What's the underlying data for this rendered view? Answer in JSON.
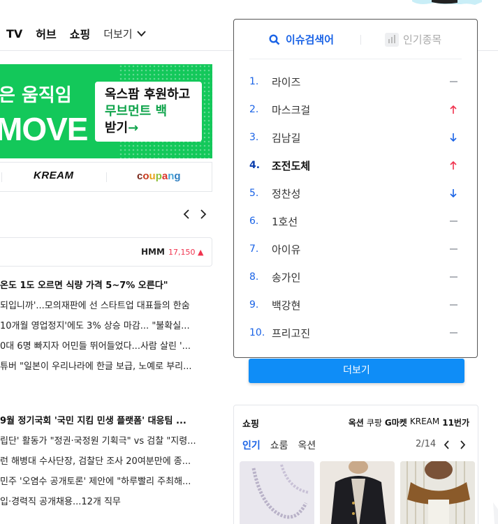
{
  "topnav": {
    "items": [
      "TV",
      "허브",
      "쇼핑"
    ],
    "more_label": "더보기"
  },
  "banner": {
    "line1": "은 움직임",
    "line2": "MOVE",
    "card_line1": "옥스팜 후원하고",
    "card_line2": "무브먼트 백",
    "card_line3": "받기",
    "card_arrow": "→"
  },
  "brands": {
    "kream": "KREAM",
    "coupang": [
      "c",
      "o",
      "u",
      "p",
      "a",
      "n",
      "g"
    ]
  },
  "stock": {
    "name": "HMM",
    "value": "17,150 ▲"
  },
  "news": {
    "group1": [
      "온도 1도 오르면 식량 가격 5~7% 오른다\"",
      "되입니까'...모의재판에 선 스타트업 대표들의 한숨",
      "10개월 영업정지'에도 3% 상승 마감... \"불확실...",
      "0대 6명 빠지자 어민들 뛰어들었다...사람 살린 '...",
      "튜버 \"일본이 우리나라에 한글 보급, 노예로 부리..."
    ],
    "group2": [
      "9월 정기국회 '국민 지킴 민생 플랫폼' 대응팀 ...",
      "립단' 활동가 \"정권·국정원 기획극\" vs 검찰 \"지령...",
      "런 해병대 수사단장, 검찰단 조사 20여분만에 종...",
      "민주 '오염수 공개토론' 제안에 \"하루빨리 주최해...",
      "입·경력직 공개채용...12개 직무"
    ]
  },
  "issue_panel": {
    "tab_active": "이슈검색어",
    "tab_inactive": "인기종목",
    "items": [
      {
        "rank": "1.",
        "name": "라이즈",
        "trend": "same"
      },
      {
        "rank": "2.",
        "name": "마스크걸",
        "trend": "up"
      },
      {
        "rank": "3.",
        "name": "김남길",
        "trend": "down"
      },
      {
        "rank": "4.",
        "name": "조전도체",
        "trend": "up"
      },
      {
        "rank": "5.",
        "name": "정찬성",
        "trend": "down"
      },
      {
        "rank": "6.",
        "name": "1호선",
        "trend": "same"
      },
      {
        "rank": "7.",
        "name": "아이유",
        "trend": "same"
      },
      {
        "rank": "8.",
        "name": "송가인",
        "trend": "same"
      },
      {
        "rank": "9.",
        "name": "백강현",
        "trend": "same"
      },
      {
        "rank": "10.",
        "name": "프리고진",
        "trend": "same"
      }
    ],
    "more_label": "더보기"
  },
  "shopping": {
    "title": "쇼핑",
    "partners": [
      "옥션",
      "쿠팡",
      "G마켓",
      "KREAM",
      "11번가"
    ],
    "tabs": [
      "인기",
      "쇼룸",
      "옥션"
    ],
    "page": "2/14"
  },
  "colors": {
    "accent_blue": "#1a63e6",
    "button_blue": "#0f8df7",
    "trend_up": "#f0344f",
    "trend_down": "#1a63e6",
    "banner_green": "#13c85a"
  }
}
